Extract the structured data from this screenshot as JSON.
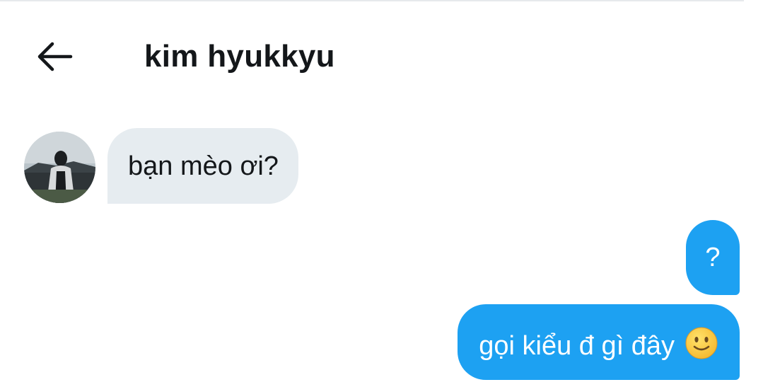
{
  "header": {
    "title": "kim hyukkyu",
    "back_icon": "arrow-left-icon"
  },
  "messages": [
    {
      "direction": "received",
      "text": "bạn mèo ơi?"
    },
    {
      "direction": "sent",
      "text": "?"
    },
    {
      "direction": "sent",
      "text": "gọi kiểu đ gì đây",
      "emoji": "slightly-smiling-face"
    }
  ],
  "colors": {
    "sent_bubble": "#1da1f2",
    "received_bubble": "#e6ecf0",
    "title_text": "#14171a"
  }
}
